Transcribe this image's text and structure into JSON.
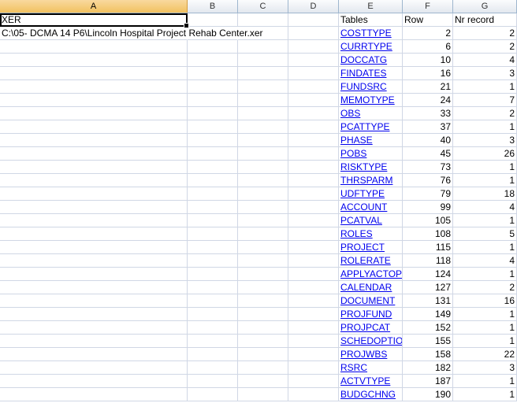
{
  "columns": [
    "A",
    "B",
    "C",
    "D",
    "E",
    "F",
    "G"
  ],
  "selected_column": "A",
  "cell_A1": "XER",
  "cell_A2": "C:\\05- DCMA 14 P6\\Lincoln Hospital Project Rehab Center.xer",
  "headers": {
    "tables": "Tables",
    "row": "Row",
    "records": "Nr record"
  },
  "table_rows": [
    {
      "table": "COSTTYPE",
      "row": "2",
      "records": "2"
    },
    {
      "table": "CURRTYPE",
      "row": "6",
      "records": "2"
    },
    {
      "table": "DOCCATG",
      "row": "10",
      "records": "4"
    },
    {
      "table": "FINDATES",
      "row": "16",
      "records": "3"
    },
    {
      "table": "FUNDSRC",
      "row": "21",
      "records": "1"
    },
    {
      "table": "MEMOTYPE",
      "row": "24",
      "records": "7"
    },
    {
      "table": "OBS",
      "row": "33",
      "records": "2"
    },
    {
      "table": "PCATTYPE",
      "row": "37",
      "records": "1"
    },
    {
      "table": "PHASE",
      "row": "40",
      "records": "3"
    },
    {
      "table": "POBS",
      "row": "45",
      "records": "26"
    },
    {
      "table": "RISKTYPE",
      "row": "73",
      "records": "1"
    },
    {
      "table": "THRSPARM",
      "row": "76",
      "records": "1"
    },
    {
      "table": "UDFTYPE",
      "row": "79",
      "records": "18"
    },
    {
      "table": "ACCOUNT",
      "row": "99",
      "records": "4"
    },
    {
      "table": "PCATVAL",
      "row": "105",
      "records": "1"
    },
    {
      "table": "ROLES",
      "row": "108",
      "records": "5"
    },
    {
      "table": "PROJECT",
      "row": "115",
      "records": "1"
    },
    {
      "table": "ROLERATE",
      "row": "118",
      "records": "4"
    },
    {
      "table": "APPLYACTOPT",
      "row": "124",
      "records": "1"
    },
    {
      "table": "CALENDAR",
      "row": "127",
      "records": "2"
    },
    {
      "table": "DOCUMENT",
      "row": "131",
      "records": "16"
    },
    {
      "table": "PROJFUND",
      "row": "149",
      "records": "1"
    },
    {
      "table": "PROJPCAT",
      "row": "152",
      "records": "1"
    },
    {
      "table": "SCHEDOPTIONS",
      "row": "155",
      "records": "1"
    },
    {
      "table": "PROJWBS",
      "row": "158",
      "records": "22"
    },
    {
      "table": "RSRC",
      "row": "182",
      "records": "3"
    },
    {
      "table": "ACTVTYPE",
      "row": "187",
      "records": "1"
    },
    {
      "table": "BUDGCHNG",
      "row": "190",
      "records": "1"
    }
  ],
  "colors": {
    "header_selected": "#f1c15f",
    "gridline": "#d0d7e5",
    "link": "#0000ee"
  }
}
